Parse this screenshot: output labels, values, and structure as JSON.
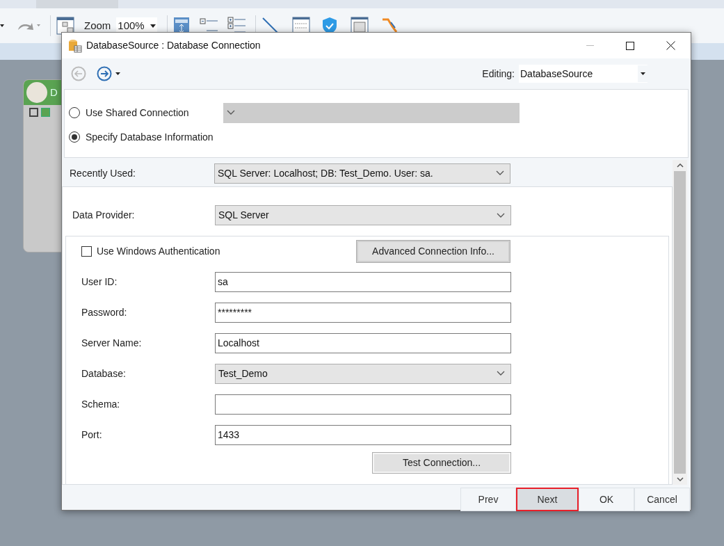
{
  "app": {
    "zoom_label": "Zoom",
    "zoom_value": "100%",
    "node_title": "D"
  },
  "dialog": {
    "title": "DatabaseSource : Database Connection",
    "editing": {
      "label": "Editing:",
      "value": "DatabaseSource"
    },
    "connection_options": [
      {
        "label": "Use Shared Connection",
        "selected": false
      },
      {
        "label": "Specify Database Information",
        "selected": true
      }
    ],
    "recently_used": {
      "label": "Recently Used:",
      "value": "SQL Server:  Localhost; DB: Test_Demo. User: sa."
    },
    "data_provider": {
      "label": "Data Provider:",
      "value": "SQL Server"
    },
    "windows_auth": {
      "label": "Use Windows Authentication",
      "checked": false
    },
    "advanced_button": "Advanced Connection Info...",
    "fields": [
      {
        "kind": "text",
        "label": "User ID:",
        "value": "sa"
      },
      {
        "kind": "text",
        "label": "Password:",
        "value": "*********"
      },
      {
        "kind": "text",
        "label": "Server Name:",
        "value": "Localhost"
      },
      {
        "kind": "select",
        "label": "Database:",
        "value": "Test_Demo"
      },
      {
        "kind": "text",
        "label": "Schema:"
      },
      {
        "kind": "text",
        "label": "Port:",
        "value": "1433"
      }
    ],
    "test_button": "Test Connection...",
    "buttons": [
      {
        "label": "Prev",
        "selected": false
      },
      {
        "label": "Next",
        "selected": true
      },
      {
        "label": "OK",
        "selected": false
      },
      {
        "label": "Cancel",
        "selected": false
      }
    ]
  }
}
